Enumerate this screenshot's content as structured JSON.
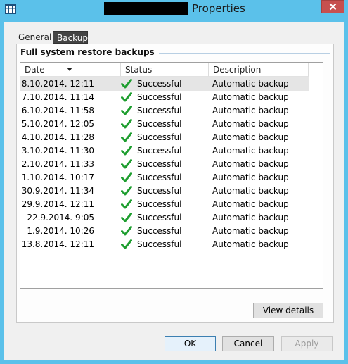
{
  "window": {
    "title": "Properties"
  },
  "tabs": [
    {
      "label": "General",
      "selected": false
    },
    {
      "label": "Backup",
      "selected": true
    }
  ],
  "group": {
    "label": "Full system restore backups"
  },
  "table": {
    "columns": [
      "Date",
      "Status",
      "Description"
    ],
    "sort_column": "Date",
    "rows": [
      {
        "date": "8.10.2014. 12:11",
        "status": "Successful",
        "description": "Automatic backup",
        "selected": true
      },
      {
        "date": "7.10.2014. 11:14",
        "status": "Successful",
        "description": "Automatic backup"
      },
      {
        "date": "6.10.2014. 11:58",
        "status": "Successful",
        "description": "Automatic backup"
      },
      {
        "date": "5.10.2014. 12:05",
        "status": "Successful",
        "description": "Automatic backup"
      },
      {
        "date": "4.10.2014. 11:28",
        "status": "Successful",
        "description": "Automatic backup"
      },
      {
        "date": "3.10.2014. 11:30",
        "status": "Successful",
        "description": "Automatic backup"
      },
      {
        "date": "2.10.2014. 11:33",
        "status": "Successful",
        "description": "Automatic backup"
      },
      {
        "date": "1.10.2014. 10:17",
        "status": "Successful",
        "description": "Automatic backup"
      },
      {
        "date": "30.9.2014. 11:34",
        "status": "Successful",
        "description": "Automatic backup"
      },
      {
        "date": "29.9.2014. 12:11",
        "status": "Successful",
        "description": "Automatic backup"
      },
      {
        "date": "22.9.2014. 9:05",
        "status": "Successful",
        "description": "Automatic backup"
      },
      {
        "date": "1.9.2014. 10:26",
        "status": "Successful",
        "description": "Automatic backup"
      },
      {
        "date": "13.8.2014. 12:11",
        "status": "Successful",
        "description": "Automatic backup"
      }
    ]
  },
  "buttons": {
    "view_details": "View details",
    "ok": "OK",
    "cancel": "Cancel",
    "apply": "Apply"
  },
  "icons": {
    "status_ok": "check-icon",
    "window": "app-icon",
    "close": "close-icon"
  },
  "colors": {
    "titlebar": "#5bc1ea",
    "check_green": "#1e9e2f",
    "close_red": "#c7504f"
  }
}
